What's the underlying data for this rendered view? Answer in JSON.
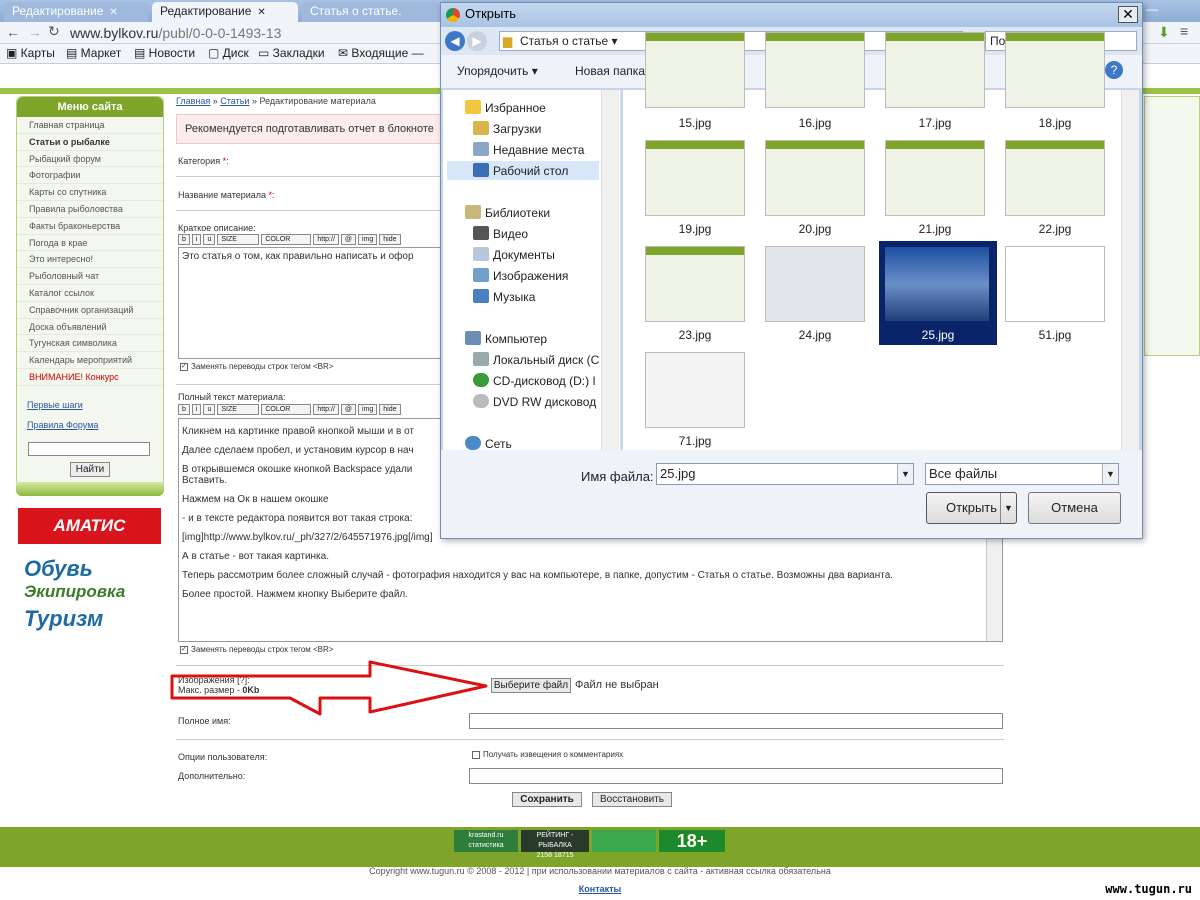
{
  "browser": {
    "tabs": [
      "Редактирование",
      "Редактирование",
      "Статья о статье."
    ],
    "address": {
      "domain": "www.bylkov.ru",
      "path": "/publ/0-0-0-1493-13"
    },
    "bookmarks": [
      "Карты",
      "Маркет",
      "Новости",
      "Диск",
      "Закладки",
      "Входящие —"
    ]
  },
  "site": {
    "menu_title": "Меню сайта",
    "menu_items": [
      "Главная страница",
      "Статьи о рыбалке",
      "Рыбацкий форум",
      "Фотографии",
      "Карты со спутника",
      "Правила рыболовства",
      "Факты браконьерства",
      "Погода в крае",
      "Это интересно!",
      "Рыболовный чат",
      "Каталог ссылок",
      "Справочник организаций",
      "Доска объявлений",
      "Тугунская символика",
      "Календарь мероприятий",
      "ВНИМАНИЕ! Конкурс"
    ],
    "links": [
      "Первые шаги",
      "Правила Форума"
    ],
    "find_button": "Найти",
    "banner": "АМАТИС",
    "brands": [
      "Обувь",
      "Экипировка",
      "Туризм"
    ]
  },
  "breadcrumb": {
    "home": "Главная",
    "sep": " » ",
    "articles": "Статьи",
    "current": "Редактирование материала"
  },
  "form": {
    "notice": "Рекомендуется подготавливать отчет в блокноте",
    "category_label": "Категория ",
    "title_label": "Название материала ",
    "required_mark": "*:",
    "short_label": "Краткое описание:",
    "toolbar": [
      "b",
      "i",
      "u",
      "SIZE",
      "COLOR",
      "http://",
      "@",
      "img",
      "hide"
    ],
    "short_text": "Это статья о том, как правильно написать и офор",
    "replace_br": "Заменять переводы строк тегом <BR>",
    "full_label": "Полный текст материала:",
    "full_text": [
      "Кликнем на картинке правой кнопкой мыши и в от",
      "Далее сделаем пробел, и установим курсор в нач",
      "В открывшемся окошке кнопкой Backspace удали",
      "Вставить.",
      "Нажмем на Ок в нашем окошке",
      "- и в тексте редактора появится вот такая строка:",
      "[img]http://www.bylkov.ru/_ph/327/2/645571976.jpg[/img]",
      "А в статье - вот такая картинка.",
      "Теперь рассмотрим более сложный случай - фотография находится у вас на компьютере, в папке, допустим - Статья о статье. Возможны два варианта.",
      "Более простой. Нажмем кнопку Выберите файл."
    ],
    "images_label": "Изображения [?]:",
    "max_size": "Макс. размер - ",
    "max_size_value": "0Kb",
    "choose_file": "Выберите файл",
    "no_file": "Файл не выбран",
    "fullname_label": "Полное имя:",
    "user_options_label": "Опции пользователя:",
    "notify_label": "Получать извещения о комментариях",
    "extra_label": "Дополнительно:",
    "save": "Сохранить",
    "restore": "Восстановить"
  },
  "footer": {
    "copyright": "Copyright www.tugun.ru © 2008 - 2012 | при использовании материалов с сайта - активная ссылка обязательна",
    "contacts": "Контакты",
    "watermark": "www.tugun.ru",
    "badges": [
      "krastand.ru статистика",
      "РЕЙТИНГ - РЫБАЛКА",
      "18+"
    ],
    "badge_nums": [
      "2158",
      "18715"
    ]
  },
  "dialog": {
    "title": "Открыть",
    "path": "Статья о статье",
    "search_placeholder": "Поиск: Статья о...",
    "organize": "Упорядочить",
    "new_folder": "Новая папка",
    "nav": {
      "favorites": "Избранное",
      "downloads": "Загрузки",
      "recent": "Недавние места",
      "desktop": "Рабочий стол",
      "libraries": "Библиотеки",
      "video": "Видео",
      "documents": "Документы",
      "images": "Изображения",
      "music": "Музыка",
      "computer": "Компьютер",
      "local_disk": "Локальный диск (С",
      "cd": "CD-дисковод (D:) I",
      "dvd": "DVD RW дисковод",
      "network": "Сеть"
    },
    "files": [
      "15.jpg",
      "16.jpg",
      "17.jpg",
      "18.jpg",
      "19.jpg",
      "20.jpg",
      "21.jpg",
      "22.jpg",
      "23.jpg",
      "24.jpg",
      "25.jpg",
      "51.jpg",
      "71.jpg"
    ],
    "selected_file": "25.jpg",
    "filename_label": "Имя файла:",
    "filename_value": "25.jpg",
    "filetype": "Все файлы",
    "open": "Открыть",
    "cancel": "Отмена"
  }
}
